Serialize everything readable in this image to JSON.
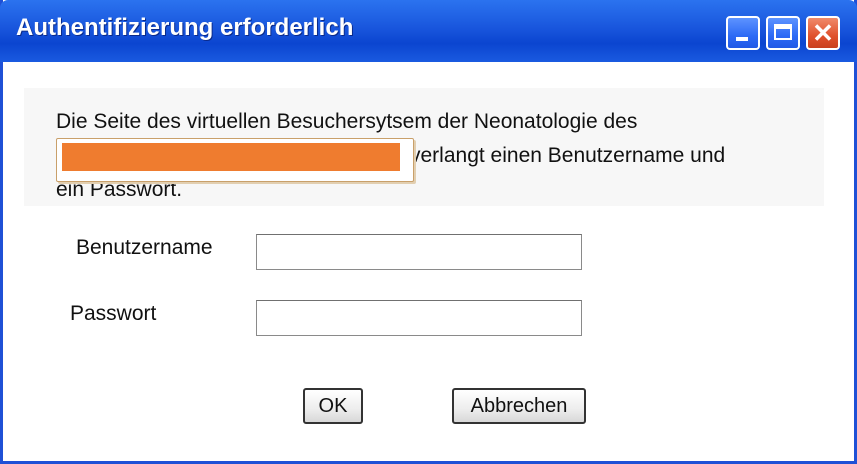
{
  "window": {
    "title": "Authentifizierung erforderlich",
    "controls": {
      "minimize": "minimize-icon",
      "maximize": "maximize-icon",
      "close": "close-icon"
    }
  },
  "message": {
    "line1": "Die Seite des virtuellen Besuchersytsem der Neonatologie des",
    "line2_after_redaction": "verlangt einen Benutzername und",
    "line3": "ein Passwort.",
    "redaction_color": "#ef7c2f"
  },
  "form": {
    "username_label": "Benutzername",
    "username_value": "",
    "password_label": "Passwort",
    "password_value": ""
  },
  "buttons": {
    "ok_label": "OK",
    "cancel_label": "Abbrechen"
  },
  "colors": {
    "titlebar": "#1956dd",
    "close_button": "#e0512c"
  }
}
